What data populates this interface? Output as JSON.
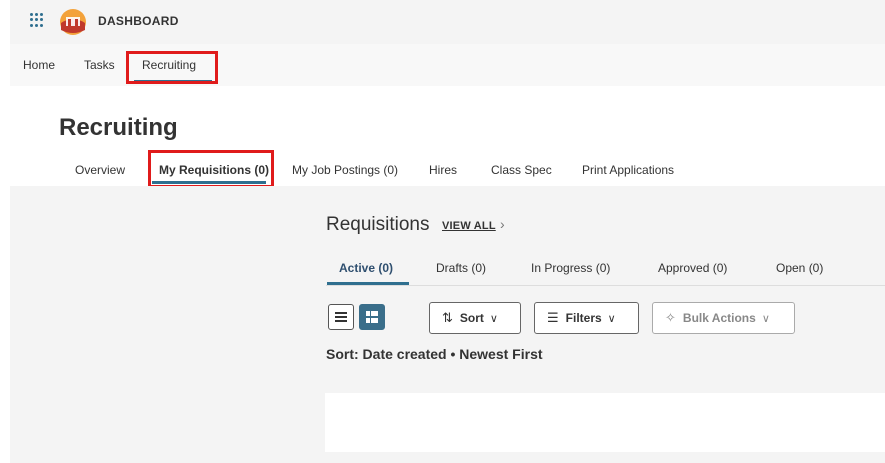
{
  "header": {
    "app_title": "DASHBOARD",
    "logo": "org-logo",
    "apps_icon": "grid-icon"
  },
  "nav": {
    "items": [
      "Home",
      "Tasks",
      "Recruiting"
    ],
    "active": "Recruiting"
  },
  "page": {
    "title": "Recruiting"
  },
  "subtabs": {
    "items": [
      "Overview",
      "My Requisitions (0)",
      "My Job Postings (0)",
      "Hires",
      "Class Spec",
      "Print Applications"
    ],
    "active": "My Requisitions (0)"
  },
  "requisitions": {
    "title": "Requisitions",
    "view_all": "VIEW ALL",
    "tabs": [
      "Active (0)",
      "Drafts (0)",
      "In Progress (0)",
      "Approved (0)",
      "Open (0)"
    ],
    "active_tab": "Active (0)",
    "toolbar": {
      "sort_label": "Sort",
      "filters_label": "Filters",
      "bulk_actions_label": "Bulk Actions"
    },
    "sort_status": "Sort: Date created • Newest First"
  },
  "colors": {
    "accent": "#2f6f8f",
    "highlight": "#e01b1b"
  }
}
